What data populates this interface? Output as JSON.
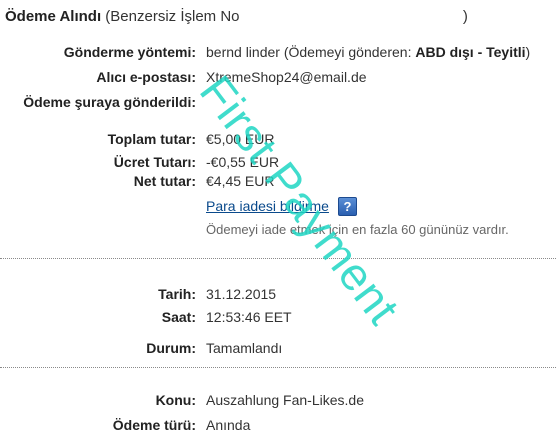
{
  "header": {
    "title": "Ödeme Alındı",
    "subtitle": "(Benzersiz İşlem No",
    "close_paren": ")"
  },
  "details": {
    "method_label": "Gönderme yöntemi:",
    "method_value_prefix": "bernd linder (Ödemeyi gönderen: ",
    "method_value_bold": "ABD dışı - Teyitli",
    "method_value_suffix": ")",
    "email_label": "Alıcı e-postası:",
    "email_value": "XtremeShop24@email.de",
    "sent_to_label": "Ödeme şuraya gönderildi:",
    "sent_to_value": ""
  },
  "amounts": {
    "total_label": "Toplam tutar:",
    "total_value": "€5,00 EUR",
    "fee_label": "Ücret Tutarı:",
    "fee_value": "-€0,55 EUR",
    "net_label": "Net tutar:",
    "net_value": "€4,45 EUR"
  },
  "refund": {
    "link_label": "Para iadesi bildirme",
    "help_icon": "question-icon",
    "help_glyph": "?",
    "note": "Ödemeyi iade etmek için en fazla 60 gününüz vardır."
  },
  "meta": {
    "date_label": "Tarih:",
    "date_value": "31.12.2015",
    "time_label": "Saat:",
    "time_value": "12:53:46 EET",
    "status_label": "Durum:",
    "status_value": "Tamamlandı"
  },
  "subject": {
    "subject_label": "Konu:",
    "subject_value": "Auszahlung Fan-Likes.de",
    "type_label": "Ödeme türü:",
    "type_value": "Anında"
  },
  "watermark": {
    "text": "First Payment",
    "color": "#1fd6c4"
  },
  "colors": {
    "link": "#0a4a8c",
    "text": "#333333",
    "label": "#222222"
  }
}
